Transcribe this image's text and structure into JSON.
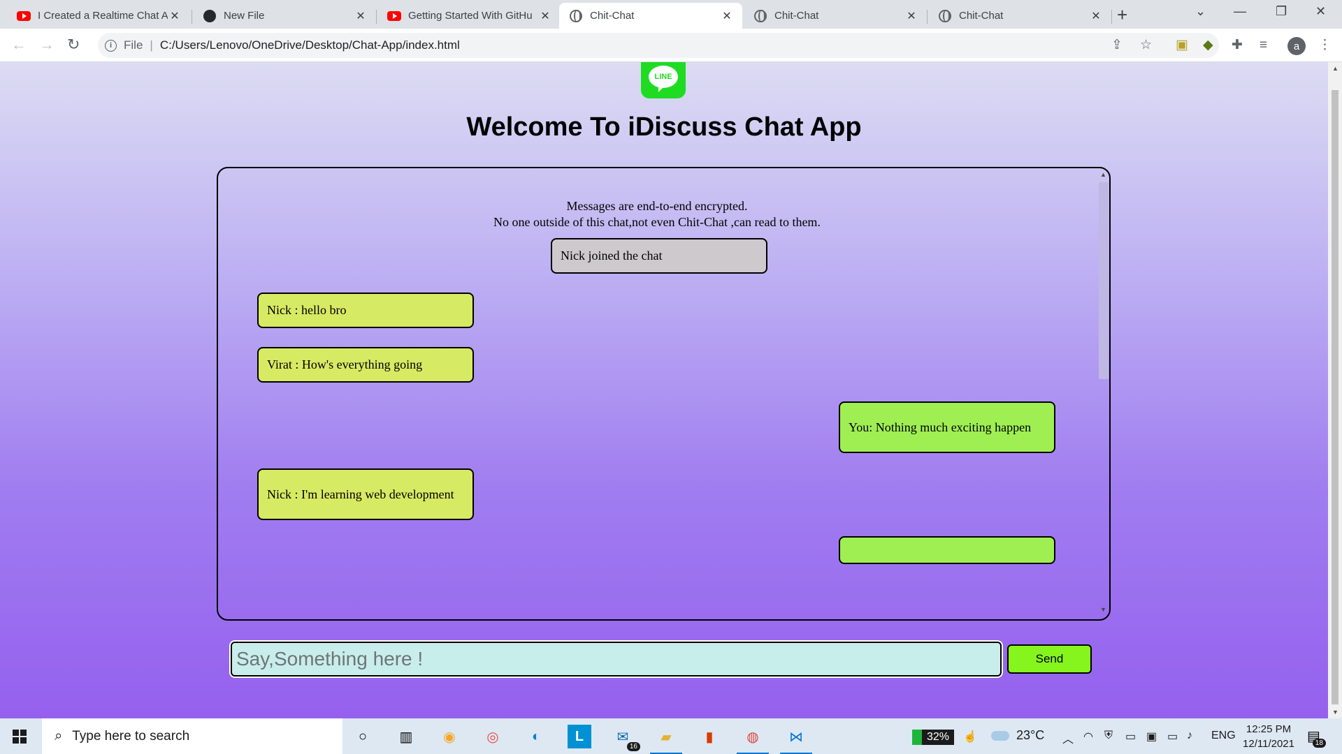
{
  "browser": {
    "tabs": [
      {
        "title": "I Created a Realtime Chat A",
        "icon": "youtube-icon"
      },
      {
        "title": "New File",
        "icon": "github-icon"
      },
      {
        "title": "Getting Started With GitHu",
        "icon": "youtube-icon"
      },
      {
        "title": "Chit-Chat",
        "icon": "globe-icon",
        "active": true
      },
      {
        "title": "Chit-Chat",
        "icon": "globe-icon"
      },
      {
        "title": "Chit-Chat",
        "icon": "globe-icon"
      }
    ],
    "address": {
      "scheme_label": "File",
      "url": "C:/Users/Lenovo/OneDrive/Desktop/Chat-App/index.html"
    },
    "profile_initial": "a"
  },
  "page": {
    "logo_text": "LINE",
    "title": "Welcome To iDiscuss Chat App",
    "notice_line1": "Messages are end-to-end encrypted.",
    "notice_line2": "No one outside of this chat,not even Chit-Chat ,can read to them.",
    "messages": [
      {
        "position": "center",
        "text": "Nick joined the chat"
      },
      {
        "position": "left",
        "text": "Nick : hello bro"
      },
      {
        "position": "left",
        "text": "Virat : How's everything going"
      },
      {
        "position": "right",
        "text": "You: Nothing much exciting happen"
      },
      {
        "position": "left",
        "text": "Nick : I'm learning web development"
      },
      {
        "position": "right",
        "text": ""
      }
    ],
    "input_placeholder": "Say,Something here !",
    "send_label": "Send"
  },
  "taskbar": {
    "search_placeholder": "Type here to search",
    "battery": "32%",
    "temperature": "23°C",
    "language": "ENG",
    "time": "12:25 PM",
    "date": "12/11/2021",
    "mail_badge": "16",
    "notification_count": "18"
  },
  "colors": {
    "accent_send": "#86f51e",
    "bubble_left": "#d7ea63",
    "bubble_right": "#9fef52",
    "bubble_center": "#cdc9cd",
    "input_bg": "#c8eeeb"
  }
}
